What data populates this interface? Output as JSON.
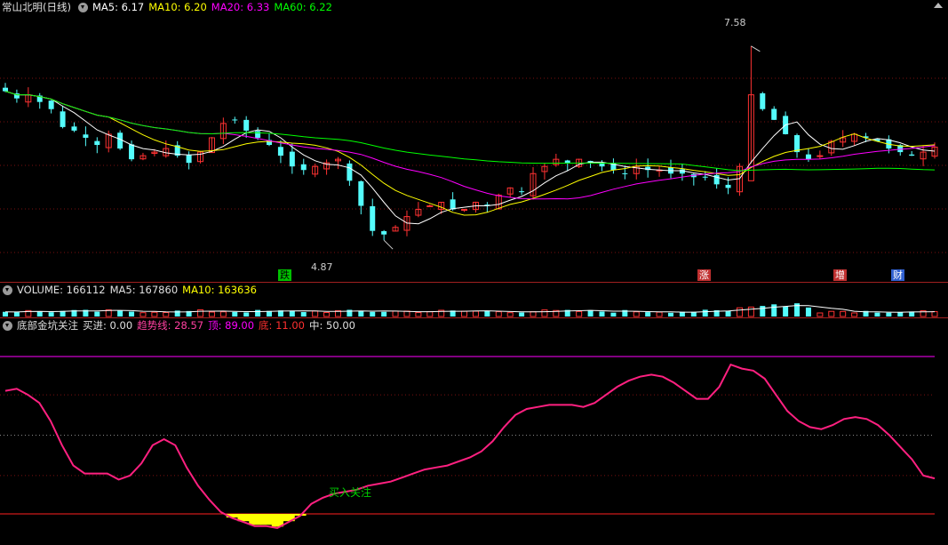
{
  "main_header": {
    "title": "常山北明(日线)",
    "ma5_label": "MA5: 6.17",
    "ma10_label": "MA10: 6.20",
    "ma20_label": "MA20: 6.33",
    "ma60_label": "MA60: 6.22"
  },
  "volume_header": {
    "volume_label": "VOLUME: 166112",
    "ma5_label": "MA5: 167860",
    "ma10_label": "MA10: 163636"
  },
  "indicator_header": {
    "name": "底部金坑关注",
    "buy_label": "买进: 0.00",
    "trend_label": "趋势线: 28.57",
    "top_label": "顶: 89.00",
    "bottom_label": "底: 11.00",
    "mid_label": "中: 50.00"
  },
  "annotations": {
    "high_price": "7.58",
    "low_price": "4.87",
    "buy_attention": "买入关注"
  },
  "event_markers": [
    {
      "label": "跌",
      "color": "#00c000"
    },
    {
      "label": "涨",
      "color": "#ff4040"
    },
    {
      "label": "增",
      "color": "#ff4040"
    },
    {
      "label": "财",
      "color": "#4aa0ff"
    }
  ],
  "colors": {
    "up": "#ff3232",
    "down": "#54fcfc",
    "ma5": "#ffffff",
    "ma10": "#ffff00",
    "ma20": "#ff00ff",
    "ma60": "#00ff00",
    "trend": "#ff2080",
    "bottom_fill": "#ffff00"
  },
  "chart_data": {
    "type": "candlestick",
    "price_ylim": [
      4.5,
      8.0
    ],
    "high": 7.58,
    "low": 4.87,
    "closes": [
      6.95,
      6.85,
      6.9,
      6.8,
      6.7,
      6.45,
      6.4,
      6.3,
      6.2,
      6.35,
      6.15,
      6.0,
      6.05,
      6.1,
      6.15,
      6.05,
      5.95,
      6.1,
      6.3,
      6.5,
      6.55,
      6.4,
      6.3,
      6.2,
      6.05,
      5.9,
      5.85,
      5.9,
      5.95,
      6.0,
      5.7,
      5.35,
      5.0,
      4.95,
      5.05,
      5.2,
      5.3,
      5.35,
      5.4,
      5.3,
      5.3,
      5.4,
      5.35,
      5.5,
      5.6,
      5.55,
      5.8,
      5.9,
      6.0,
      5.95,
      6.0,
      5.95,
      5.9,
      5.85,
      5.8,
      5.9,
      5.85,
      5.85,
      5.8,
      5.8,
      5.75,
      5.75,
      5.65,
      5.6,
      5.9,
      6.9,
      6.7,
      6.55,
      6.35,
      6.1,
      6.0,
      6.05,
      6.25,
      6.3,
      6.35,
      6.3,
      6.25,
      6.15,
      6.1,
      6.05,
      6.1,
      6.17
    ],
    "volume_ylim": [
      0,
      600000
    ],
    "volume_last": 166112,
    "indicator": {
      "name": "底部金坑关注",
      "ylim": [
        0,
        100
      ],
      "top": 89,
      "bottom": 11,
      "mid": 50,
      "buy": 0,
      "trend_last": 28.57,
      "trend": [
        72,
        73,
        70,
        66,
        57,
        45,
        35,
        31,
        31,
        31,
        28,
        30,
        36,
        45,
        48,
        45,
        34,
        25,
        18,
        12,
        9,
        7,
        5,
        5,
        4,
        7,
        10,
        16,
        19,
        21,
        22,
        23,
        25,
        26,
        27,
        29,
        31,
        33,
        34,
        35,
        37,
        39,
        42,
        47,
        54,
        60,
        63,
        64,
        65,
        65,
        65,
        64,
        66,
        70,
        74,
        77,
        79,
        80,
        79,
        76,
        72,
        68,
        68,
        74,
        85,
        83,
        82,
        78,
        70,
        62,
        57,
        54,
        53,
        55,
        58,
        59,
        58,
        55,
        50,
        44,
        38,
        30,
        28.57
      ]
    }
  }
}
